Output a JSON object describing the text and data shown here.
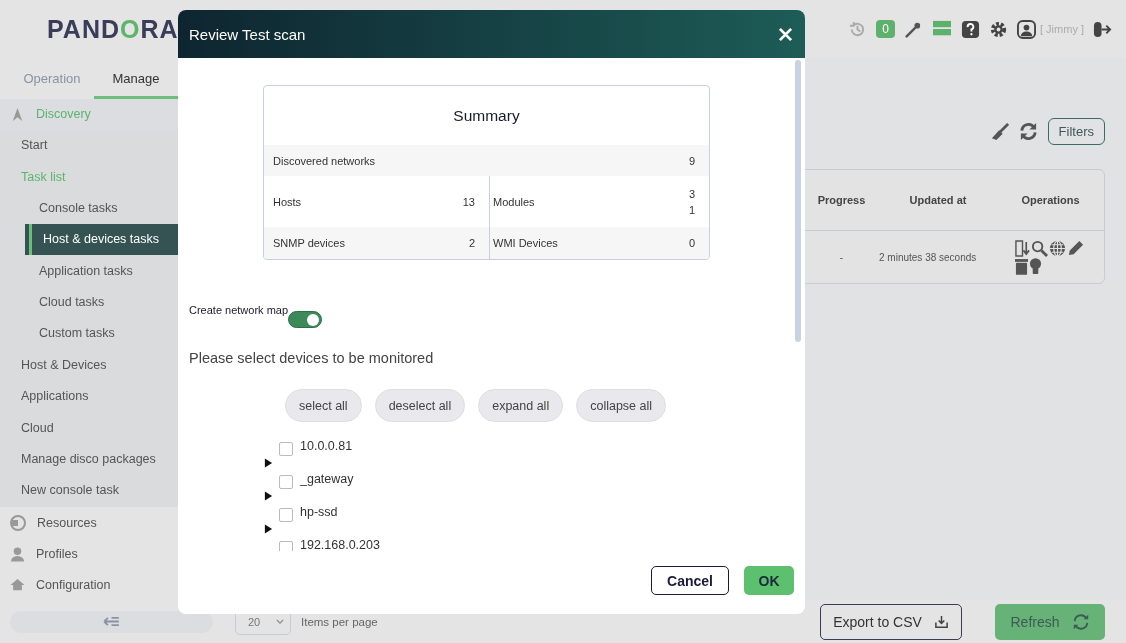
{
  "header": {
    "logo": "PANDORA",
    "badge": "0",
    "user": "[ Jimmy ]"
  },
  "tabs": [
    {
      "label": "Operation",
      "selected": false
    },
    {
      "label": "Manage",
      "selected": true
    }
  ],
  "menu": [
    {
      "label": "Discovery",
      "expanded": true,
      "children": [
        {
          "label": "Start",
          "selected": false
        },
        {
          "label": "Task list",
          "children": [
            {
              "label": "Console tasks",
              "selected": false
            },
            {
              "label": "Host & devices tasks",
              "selected": true
            },
            {
              "label": "Application tasks",
              "selected": false
            },
            {
              "label": "Cloud tasks",
              "selected": false
            },
            {
              "label": "Custom tasks",
              "selected": false
            }
          ]
        },
        {
          "label": "Host & Devices",
          "selected": false
        },
        {
          "label": "Applications",
          "selected": false
        },
        {
          "label": "Cloud",
          "selected": false
        },
        {
          "label": "Manage disco packages",
          "selected": false
        },
        {
          "label": "New console task",
          "selected": false
        }
      ]
    },
    {
      "label": "Resources"
    },
    {
      "label": "Profiles"
    },
    {
      "label": "Configuration"
    }
  ],
  "toolbar": {
    "filters": "Filters"
  },
  "table": {
    "columns": [
      "Progress",
      "Updated at",
      "Operations"
    ],
    "rows": [
      {
        "cells": [
          "-",
          "2 minutes 38 seconds"
        ]
      }
    ]
  },
  "footer": {
    "page_size": "20",
    "page_size_label": "Items per page",
    "export": "Export to CSV",
    "refresh": "Refresh"
  },
  "dialog": {
    "title": "Review Test scan",
    "summary": {
      "title": "Summary",
      "rows": [
        [
          {
            "label": "Discovered networks",
            "values": [
              "9"
            ]
          }
        ],
        [
          {
            "label": "Hosts",
            "values": [
              "13"
            ]
          },
          {
            "label": "Modules",
            "values": [
              "3",
              "1"
            ]
          }
        ],
        [
          {
            "label": "SNMP devices",
            "values": [
              "2"
            ]
          },
          {
            "label": "WMI Devices",
            "values": [
              "0"
            ]
          }
        ]
      ]
    },
    "network_map": {
      "label": "Create network map",
      "on": true
    },
    "instruction": "Please select devices to be monitored",
    "tree_buttons": [
      "select all",
      "deselect all",
      "expand all",
      "collapse all"
    ],
    "devices": [
      {
        "name": "10.0.0.81",
        "checked": false,
        "expanded": false
      },
      {
        "name": "_gateway",
        "checked": false,
        "expanded": false
      },
      {
        "name": "hp-ssd",
        "checked": false,
        "expanded": false
      },
      {
        "name": "192.168.0.203",
        "checked": false
      }
    ],
    "buttons": {
      "cancel": "Cancel",
      "ok": "OK"
    }
  }
}
